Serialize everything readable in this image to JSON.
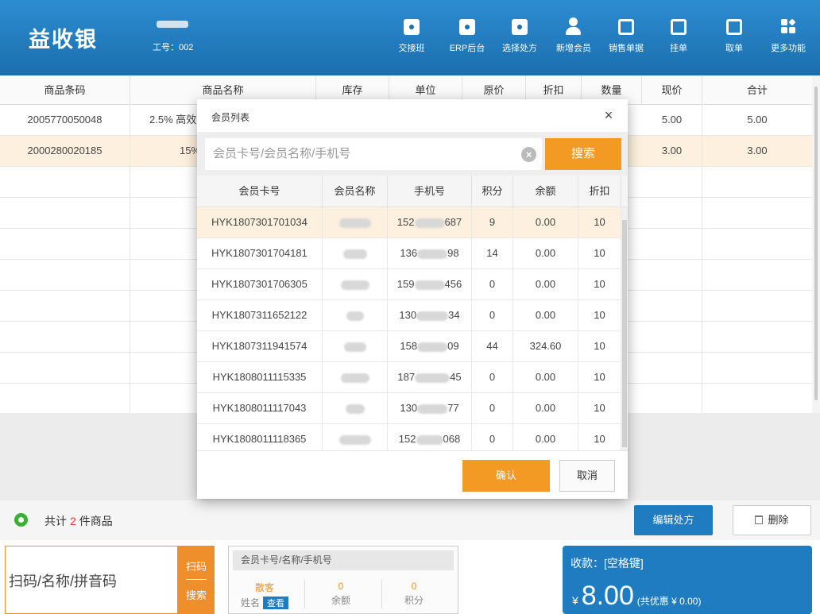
{
  "app": {
    "logo": "益收银",
    "user_id": "工号：002"
  },
  "toolbar": [
    {
      "label": "交接班",
      "icon": "handover-icon"
    },
    {
      "label": "ERP后台",
      "icon": "erp-icon"
    },
    {
      "label": "选择处方",
      "icon": "prescription-icon"
    },
    {
      "label": "新增会员",
      "icon": "add-member-icon"
    },
    {
      "label": "销售单据",
      "icon": "sales-doc-icon"
    },
    {
      "label": "挂单",
      "icon": "hold-order-icon"
    },
    {
      "label": "取单",
      "icon": "retrieve-order-icon"
    },
    {
      "label": "更多功能",
      "icon": "more-icon"
    }
  ],
  "table": {
    "headers": [
      "商品条码",
      "商品名称",
      "库存",
      "单位",
      "原价",
      "折扣",
      "数量",
      "现价",
      "合计"
    ],
    "rows": [
      {
        "barcode": "2005770050048",
        "name": "2.5% 高效",
        "price_now": "5.00",
        "total": "5.00"
      },
      {
        "barcode": "2000280020185",
        "name": "15%",
        "price_now": "3.00",
        "total": "3.00"
      }
    ]
  },
  "summary": {
    "prefix": "共计",
    "count": "2",
    "suffix": "件商品",
    "edit_label": "编辑处方",
    "delete_label": "删除"
  },
  "bottom": {
    "scan_placeholder": "扫码/名称/拼音码",
    "scan_label": "扫码",
    "search_label": "搜索",
    "member_placeholder": "会员卡号/名称/手机号",
    "guest_value": "散客",
    "guest_label": "姓名",
    "view_label": "查看",
    "balance_value": "0",
    "balance_label": "余额",
    "points_value": "0",
    "points_label": "积分",
    "pay_label": "收款：[空格键]",
    "pay_currency": "¥",
    "pay_amount": "8.00",
    "pay_discount": "(共优惠 ¥ 0.00)"
  },
  "dialog": {
    "title": "会员列表",
    "close": "×",
    "search_placeholder": "会员卡号/会员名称/手机号",
    "search_button": "搜索",
    "headers": [
      "会员卡号",
      "会员名称",
      "手机号",
      "积分",
      "余额",
      "折扣"
    ],
    "members": [
      {
        "card": "HYK1807301701034",
        "phone_start": "152",
        "phone_end": "687",
        "points": "9",
        "balance": "0.00",
        "discount": "10"
      },
      {
        "card": "HYK1807301704181",
        "phone_start": "136",
        "phone_end": "98",
        "points": "14",
        "balance": "0.00",
        "discount": "10"
      },
      {
        "card": "HYK1807301706305",
        "phone_start": "159",
        "phone_end": "456",
        "points": "0",
        "balance": "0.00",
        "discount": "10"
      },
      {
        "card": "HYK1807311652122",
        "phone_start": "130",
        "phone_end": "34",
        "points": "0",
        "balance": "0.00",
        "discount": "10"
      },
      {
        "card": "HYK1807311941574",
        "phone_start": "158",
        "phone_end": "09",
        "points": "44",
        "balance": "324.60",
        "discount": "10"
      },
      {
        "card": "HYK1808011115335",
        "phone_start": "187",
        "phone_end": "45",
        "points": "0",
        "balance": "0.00",
        "discount": "10"
      },
      {
        "card": "HYK1808011117043",
        "phone_start": "130",
        "phone_end": "77",
        "points": "0",
        "balance": "0.00",
        "discount": "10"
      },
      {
        "card": "HYK1808011118365",
        "phone_start": "152",
        "phone_end": "068",
        "points": "0",
        "balance": "0.00",
        "discount": "10"
      }
    ],
    "ok_button": "确认",
    "cancel_button": "取消"
  },
  "colors": {
    "header_blue": "#1a6fae",
    "accent_orange": "#f39a24",
    "selected_row": "#fdf0de",
    "action_blue": "#1f7cc0"
  }
}
